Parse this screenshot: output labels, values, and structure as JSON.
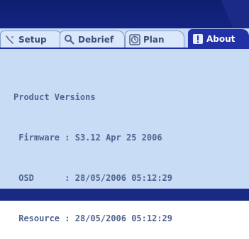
{
  "tabs": [
    {
      "label": "Setup",
      "icon": "wrench-icon",
      "active": false
    },
    {
      "label": "Debrief",
      "icon": "magnifier-icon",
      "active": false
    },
    {
      "label": "Plan",
      "icon": "clock-icon",
      "active": false
    },
    {
      "label": "About",
      "icon": "info-icon",
      "active": true
    }
  ],
  "about": {
    "heading": "Product Versions",
    "rows": [
      {
        "label": "Firmware",
        "sep": " : ",
        "value": "S3.12 Apr 25 2006"
      },
      {
        "label": "OSD",
        "sep": "      : ",
        "value": "28/05/2006 05:12:29"
      },
      {
        "label": "Resource",
        "sep": " : ",
        "value": "28/05/2006 05:12:29"
      }
    ]
  },
  "colors": {
    "bezel": "#132582",
    "screen_bg": "#c9dcf6",
    "active_tab": "#2231a5",
    "text": "#4f6591"
  }
}
